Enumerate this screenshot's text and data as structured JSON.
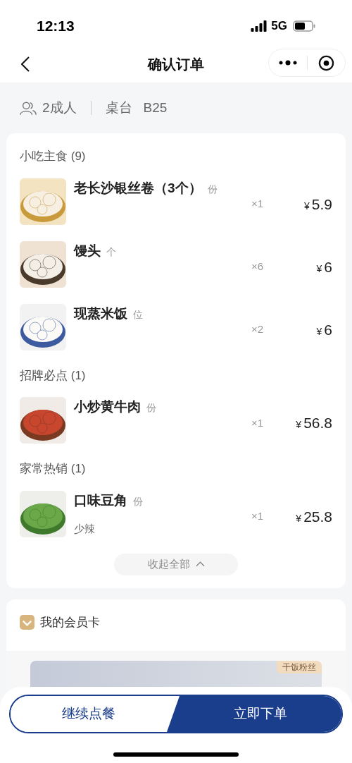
{
  "status_bar": {
    "time": "12:13",
    "network": "5G"
  },
  "nav": {
    "title": "确认订单"
  },
  "info": {
    "guests": "2成人",
    "table_label": "桌台",
    "table": "B25"
  },
  "groups": [
    {
      "title": "小吃主食 (9)",
      "items": [
        {
          "name": "老长沙银丝卷（3个）",
          "unit": "份",
          "qty": "×1",
          "currency": "¥",
          "price": "5.9"
        },
        {
          "name": "馒头",
          "unit": "个",
          "qty": "×6",
          "currency": "¥",
          "price": "6"
        },
        {
          "name": "现蒸米饭",
          "unit": "位",
          "qty": "×2",
          "currency": "¥",
          "price": "6"
        }
      ]
    },
    {
      "title": "招牌必点 (1)",
      "items": [
        {
          "name": "小炒黄牛肉",
          "unit": "份",
          "qty": "×1",
          "currency": "¥",
          "price": "56.8"
        }
      ]
    },
    {
      "title": "家常热销 (1)",
      "items": [
        {
          "name": "口味豆角",
          "unit": "份",
          "note": "少辣",
          "qty": "×1",
          "currency": "¥",
          "price": "25.8"
        }
      ]
    }
  ],
  "collapse_button": "收起全部",
  "member": {
    "title": "我的会员卡",
    "tag": "干饭粉丝"
  },
  "actions": {
    "continue": "继续点餐",
    "submit": "立即下单"
  }
}
